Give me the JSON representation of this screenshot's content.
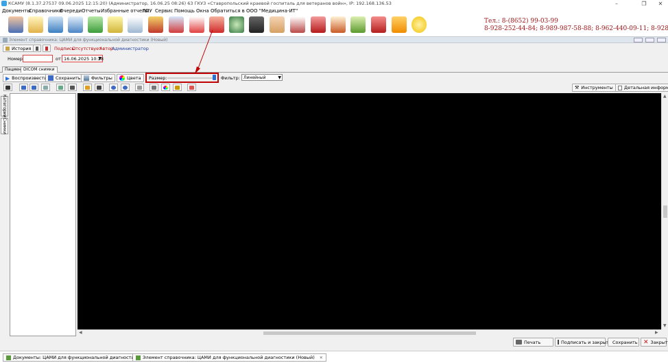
{
  "window": {
    "title": "КСАМУ (8.1.37.27537 09.06.2025 12:15:20) (Администратор, 16.06.25 08:26)  63 ГКУЗ «Ставропольский краевой госпиталь для ветеранов войн», IP: 192.168.136.53",
    "minimize": "–",
    "restore": "❐",
    "close": "✕"
  },
  "menu": [
    "Документы",
    "Справочники",
    "Очереди",
    "Отчеты",
    "Избранные отчеты",
    "ЛПУ",
    "Сервис",
    "Помощь",
    "Окна",
    "Обратиться в ООО \"Медицина-ИТ\""
  ],
  "phones": {
    "line1": "Тел.: 8-(8652) 99-03-99",
    "line2": "8-928-252-44-84; 8-989-987-58-88; 8-962-440-09-11; 8-928-252-44-52"
  },
  "subwindow": {
    "title": "Элемент справочника: ЦАМИ для функциональной диагностики (Новый)",
    "history_label": "История",
    "signature_label": "Подпись:",
    "signature_value": "Отсутствует",
    "author_label": "Автор:",
    "author_value": "Администратор",
    "number_label": "Номер:",
    "number_value": "",
    "date_from_label": "от",
    "date_value": "16.06.2025 10:28"
  },
  "tabs": [
    "Пациент",
    "DICOM снимки"
  ],
  "dicom_toolbar": {
    "play": "Воспроизвести",
    "save": "Сохранить",
    "filters": "Фильтры",
    "colors": "Цвета",
    "size_label": "Размер:",
    "filter_label": "Фильтр:",
    "filter_value": "Линейный"
  },
  "right_buttons": {
    "tools": "Инструменты",
    "details": "Детальная информация"
  },
  "side_tabs": [
    "Категории",
    "Снимки"
  ],
  "bottom_buttons": {
    "print": "Печать",
    "sign_close": "Подписать и закрыть",
    "save": "Сохранить",
    "close": "Закрыть"
  },
  "taskbar": [
    "Документы: ЦАМИ для функциональной диагностики",
    "Элемент справочника: ЦАМИ для функциональной диагностики (Новый)"
  ],
  "colors": {
    "accent_red": "#c00000",
    "phone_color": "#a0161a"
  }
}
